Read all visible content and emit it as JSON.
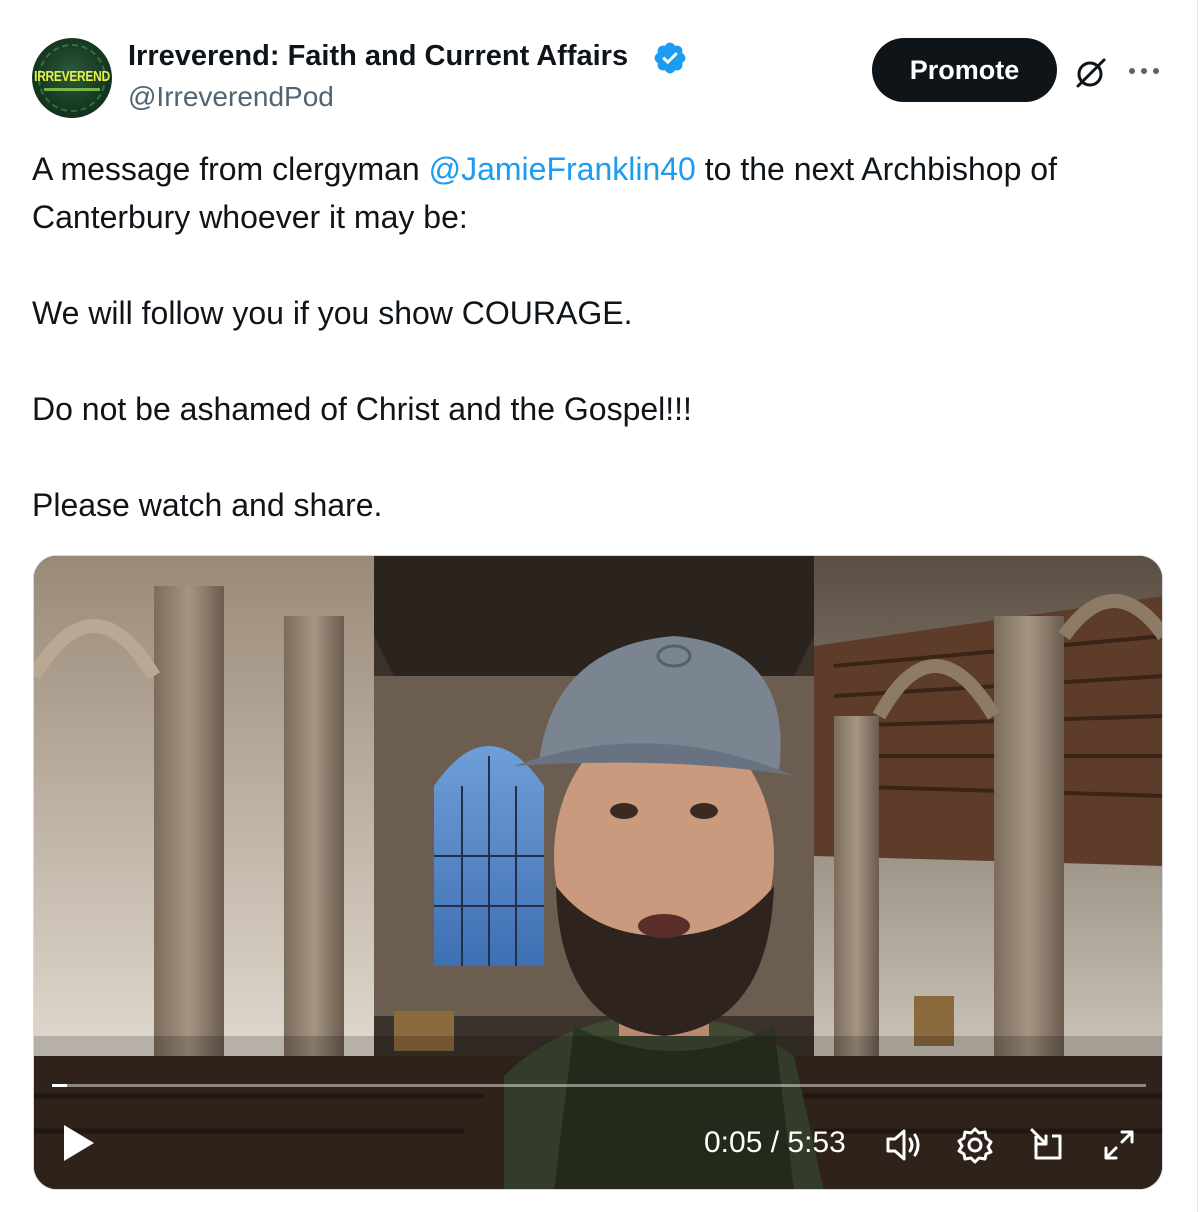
{
  "author": {
    "display_name": "Irreverend: Faith and Current Affairs",
    "handle": "@IrreverendPod",
    "avatar_text": "IRREVEREND",
    "verified_icon": "verified-badge-icon"
  },
  "header_actions": {
    "promote_label": "Promote",
    "grok_icon": "grok-icon",
    "more_icon": "more-icon"
  },
  "tweet": {
    "line1_prefix": "A message from clergyman ",
    "mention": "@JamieFranklin40",
    "line1_suffix": " to the next Archbishop of Canterbury whoever it may be:",
    "para2": "We will follow you if you show COURAGE.",
    "para3": "Do not be ashamed of Christ and the Gospel!!!",
    "para4": "Please watch and share."
  },
  "video": {
    "time_display": "0:05 / 5:53",
    "progress_fraction": 0.014,
    "icons": [
      "play-icon",
      "volume-icon",
      "settings-icon",
      "pip-icon",
      "fullscreen-icon"
    ]
  },
  "colors": {
    "text": "#0f1419",
    "secondary": "#536471",
    "link": "#1d9bf0",
    "verified": "#1d9bf0",
    "button_bg": "#0f1419"
  }
}
